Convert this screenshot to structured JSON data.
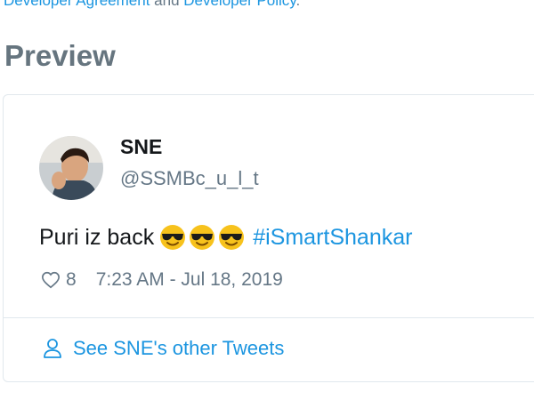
{
  "header": {
    "agreement_link": "Developer Agreement",
    "and_text": " and ",
    "policy_link": "Developer Policy",
    "period": "."
  },
  "preview_title": "Preview",
  "tweet": {
    "display_name": "SNE",
    "handle": "@SSMBc_u_l_t",
    "text": "Puri iz back",
    "emoji": [
      "smiling-face-with-sunglasses",
      "smiling-face-with-sunglasses",
      "smiling-face-with-sunglasses"
    ],
    "hashtag": "#iSmartShankar",
    "likes": "8",
    "timestamp": "7:23 AM - Jul 18, 2019",
    "other_tweets_link": "See SNE's other Tweets"
  },
  "colors": {
    "link": "#1b95e0",
    "secondary_text": "#657786",
    "primary_text": "#14171a",
    "border": "#e1e8ed"
  },
  "icons": {
    "like": "heart-icon",
    "profile": "person-icon"
  }
}
